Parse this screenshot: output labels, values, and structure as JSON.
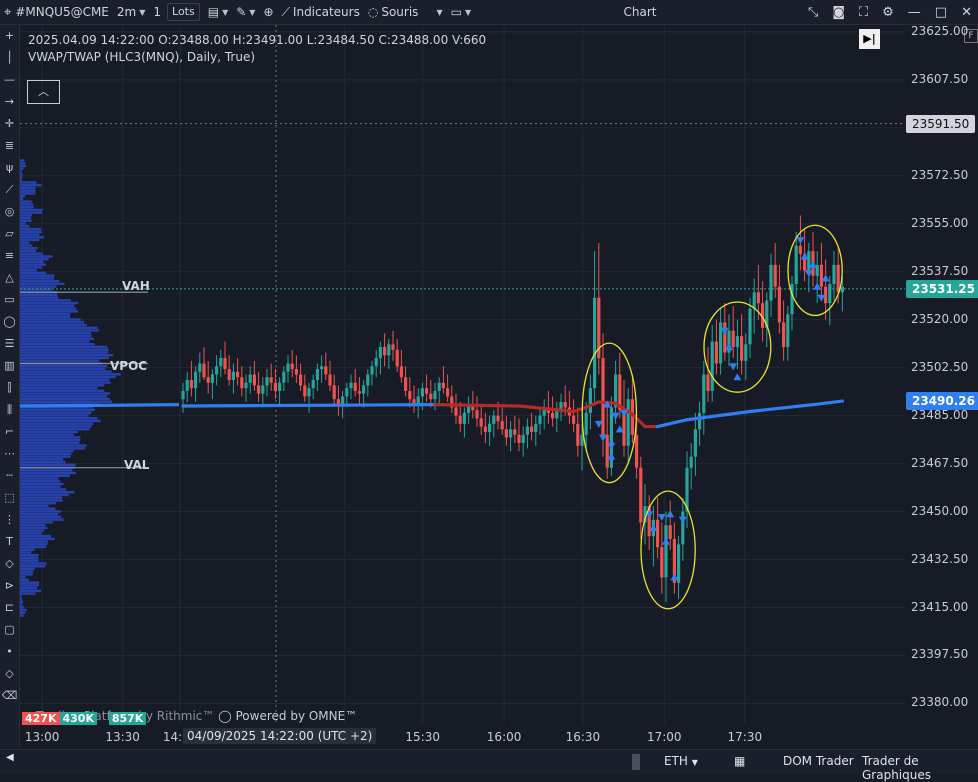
{
  "toolbar": {
    "symbol": "#MNQU5@CME",
    "timeframe": "2m",
    "lots_value": "1",
    "lots_unit": "Lots",
    "indicators_label": "Indicateurs",
    "mouse_label": "Souris",
    "window_title": "Chart"
  },
  "info": {
    "ohlc_line": "2025.04.09 14:22:00 O:23488.00 H:23491.00 L:23484.50 C:23488.00 V:660",
    "indicator_line": "VWAP/TWAP (HLC3(MNQ), Daily, True)"
  },
  "profile_labels": {
    "vah": "VAH",
    "vpoc": "VPOC",
    "val": "VAL"
  },
  "crosshair_time": "04/09/2025 14:22:00 (UTC +2)",
  "watermark": "Powered by OMNE™",
  "watermark_left": "Trading Platform by Rithmic™",
  "volume_labels": [
    "427K",
    "430K",
    "857K"
  ],
  "footer": {
    "session": "ETH",
    "dom": "DOM Trader",
    "trader": "Trader de Graphiques"
  },
  "colors": {
    "up": "#26a69a",
    "down": "#ef5350",
    "vwap_above": "#2f7ff0",
    "vwap_below": "#b52a2a",
    "background": "#161b26",
    "profile": "#2a49c7",
    "annotation": "#e8e52e"
  },
  "chart_data": {
    "type": "candlestick",
    "y_ticks": [
      "23625.00",
      "23607.50",
      "23590.00",
      "23572.50",
      "23555.00",
      "23537.50",
      "23520.00",
      "23502.50",
      "23485.00",
      "23467.50",
      "23450.00",
      "23432.50",
      "23415.00",
      "23397.50",
      "23380.00"
    ],
    "x_ticks": [
      "13:00",
      "13:30",
      "14:00",
      "15:00",
      "15:30",
      "16:00",
      "16:30",
      "17:00",
      "17:30"
    ],
    "x_tick_pos": [
      0.025,
      0.116,
      0.181,
      0.367,
      0.455,
      0.547,
      0.636,
      0.728,
      0.819
    ],
    "ylim": [
      23372.5,
      23627.5
    ],
    "price_tags": [
      {
        "value": "23591.50",
        "kind": "crosshair"
      },
      {
        "value": "23531.25",
        "kind": "last"
      },
      {
        "value": "23490.26",
        "kind": "vwap"
      }
    ],
    "levels": {
      "vah": 23530.0,
      "vpoc": 23504.0,
      "val": 23466.0
    },
    "candles": [
      [
        23491,
        23497,
        23486,
        23494
      ],
      [
        23494,
        23501,
        23490,
        23498
      ],
      [
        23498,
        23505,
        23492,
        23495
      ],
      [
        23495,
        23503,
        23490,
        23501
      ],
      [
        23501,
        23508,
        23497,
        23504
      ],
      [
        23504,
        23510,
        23498,
        23499
      ],
      [
        23499,
        23505,
        23493,
        23497
      ],
      [
        23497,
        23502,
        23491,
        23500
      ],
      [
        23500,
        23507,
        23496,
        23503
      ],
      [
        23503,
        23509,
        23499,
        23506
      ],
      [
        23506,
        23512,
        23500,
        23502
      ],
      [
        23502,
        23507,
        23496,
        23498
      ],
      [
        23498,
        23504,
        23493,
        23501
      ],
      [
        23501,
        23506,
        23496,
        23499
      ],
      [
        23499,
        23503,
        23492,
        23495
      ],
      [
        23495,
        23500,
        23490,
        23497
      ],
      [
        23497,
        23503,
        23493,
        23500
      ],
      [
        23500,
        23505,
        23494,
        23496
      ],
      [
        23496,
        23501,
        23490,
        23493
      ],
      [
        23493,
        23499,
        23488,
        23496
      ],
      [
        23496,
        23502,
        23492,
        23499
      ],
      [
        23499,
        23504,
        23494,
        23497
      ],
      [
        23497,
        23502,
        23491,
        23494
      ],
      [
        23494,
        23499,
        23489,
        23497
      ],
      [
        23497,
        23503,
        23494,
        23501
      ],
      [
        23501,
        23507,
        23497,
        23504
      ],
      [
        23504,
        23509,
        23499,
        23502
      ],
      [
        23502,
        23507,
        23497,
        23500
      ],
      [
        23500,
        23504,
        23494,
        23496
      ],
      [
        23496,
        23500,
        23490,
        23492
      ],
      [
        23492,
        23497,
        23486,
        23495
      ],
      [
        23495,
        23500,
        23491,
        23498
      ],
      [
        23498,
        23504,
        23494,
        23502
      ],
      [
        23502,
        23507,
        23497,
        23503
      ],
      [
        23503,
        23508,
        23498,
        23500
      ],
      [
        23500,
        23505,
        23494,
        23496
      ],
      [
        23496,
        23500,
        23489,
        23491
      ],
      [
        23491,
        23496,
        23485,
        23489
      ],
      [
        23489,
        23494,
        23484,
        23492
      ],
      [
        23492,
        23497,
        23488,
        23495
      ],
      [
        23495,
        23500,
        23491,
        23497
      ],
      [
        23497,
        23502,
        23492,
        23494
      ],
      [
        23494,
        23499,
        23489,
        23493
      ],
      [
        23493,
        23498,
        23488,
        23496
      ],
      [
        23496,
        23502,
        23492,
        23500
      ],
      [
        23500,
        23505,
        23496,
        23503
      ],
      [
        23503,
        23509,
        23499,
        23506
      ],
      [
        23506,
        23512,
        23500,
        23510
      ],
      [
        23510,
        23515,
        23503,
        23507
      ],
      [
        23507,
        23513,
        23502,
        23511
      ],
      [
        23511,
        23516,
        23505,
        23509
      ],
      [
        23509,
        23513,
        23501,
        23503
      ],
      [
        23503,
        23509,
        23497,
        23499
      ],
      [
        23499,
        23503,
        23492,
        23494
      ],
      [
        23494,
        23499,
        23488,
        23491
      ],
      [
        23491,
        23496,
        23486,
        23489
      ],
      [
        23489,
        23495,
        23484,
        23492
      ],
      [
        23492,
        23497,
        23487,
        23495
      ],
      [
        23495,
        23500,
        23490,
        23493
      ],
      [
        23493,
        23498,
        23488,
        23491
      ],
      [
        23491,
        23497,
        23487,
        23494
      ],
      [
        23494,
        23499,
        23489,
        23497
      ],
      [
        23497,
        23503,
        23493,
        23495
      ],
      [
        23495,
        23500,
        23490,
        23492
      ],
      [
        23492,
        23496,
        23486,
        23488
      ],
      [
        23488,
        23493,
        23482,
        23485
      ],
      [
        23485,
        23490,
        23479,
        23482
      ],
      [
        23482,
        23488,
        23477,
        23486
      ],
      [
        23486,
        23492,
        23482,
        23489
      ],
      [
        23489,
        23494,
        23484,
        23487
      ],
      [
        23487,
        23492,
        23481,
        23484
      ],
      [
        23484,
        23489,
        23478,
        23481
      ],
      [
        23481,
        23486,
        23475,
        23479
      ],
      [
        23479,
        23485,
        23474,
        23482
      ],
      [
        23482,
        23487,
        23477,
        23485
      ],
      [
        23485,
        23490,
        23480,
        23483
      ],
      [
        23483,
        23488,
        23478,
        23480
      ],
      [
        23480,
        23485,
        23474,
        23477
      ],
      [
        23477,
        23483,
        23472,
        23480
      ],
      [
        23480,
        23485,
        23475,
        23478
      ],
      [
        23478,
        23484,
        23472,
        23475
      ],
      [
        23475,
        23481,
        23470,
        23478
      ],
      [
        23478,
        23484,
        23473,
        23481
      ],
      [
        23481,
        23486,
        23476,
        23479
      ],
      [
        23479,
        23485,
        23474,
        23482
      ],
      [
        23482,
        23488,
        23478,
        23485
      ],
      [
        23485,
        23491,
        23480,
        23488
      ],
      [
        23488,
        23494,
        23482,
        23486
      ],
      [
        23486,
        23492,
        23481,
        23484
      ],
      [
        23484,
        23490,
        23479,
        23487
      ],
      [
        23487,
        23493,
        23483,
        23490
      ],
      [
        23490,
        23496,
        23485,
        23488
      ],
      [
        23488,
        23494,
        23482,
        23485
      ],
      [
        23485,
        23491,
        23479,
        23482
      ],
      [
        23482,
        23488,
        23470,
        23474
      ],
      [
        23474,
        23482,
        23465,
        23478
      ],
      [
        23478,
        23490,
        23472,
        23486
      ],
      [
        23486,
        23500,
        23480,
        23495
      ],
      [
        23495,
        23545,
        23490,
        23528
      ],
      [
        23528,
        23548,
        23500,
        23506
      ],
      [
        23506,
        23515,
        23470,
        23478
      ],
      [
        23478,
        23488,
        23462,
        23466
      ],
      [
        23466,
        23492,
        23463,
        23488
      ],
      [
        23488,
        23505,
        23482,
        23500
      ],
      [
        23500,
        23508,
        23484,
        23487
      ],
      [
        23487,
        23498,
        23470,
        23474
      ],
      [
        23474,
        23495,
        23468,
        23491
      ],
      [
        23491,
        23500,
        23475,
        23478
      ],
      [
        23478,
        23486,
        23462,
        23466
      ],
      [
        23466,
        23470,
        23440,
        23446
      ],
      [
        23446,
        23460,
        23438,
        23452
      ],
      [
        23452,
        23456,
        23436,
        23441
      ],
      [
        23441,
        23452,
        23430,
        23447
      ],
      [
        23447,
        23455,
        23433,
        23437
      ],
      [
        23437,
        23446,
        23420,
        23426
      ],
      [
        23426,
        23450,
        23417,
        23445
      ],
      [
        23445,
        23454,
        23436,
        23440
      ],
      [
        23440,
        23446,
        23420,
        23424
      ],
      [
        23424,
        23441,
        23418,
        23438
      ],
      [
        23438,
        23455,
        23432,
        23450
      ],
      [
        23450,
        23472,
        23444,
        23466
      ],
      [
        23466,
        23475,
        23458,
        23470
      ],
      [
        23470,
        23486,
        23463,
        23480
      ],
      [
        23480,
        23490,
        23474,
        23486
      ],
      [
        23486,
        23505,
        23478,
        23500
      ],
      [
        23500,
        23510,
        23490,
        23494
      ],
      [
        23494,
        23518,
        23490,
        23512
      ],
      [
        23512,
        23520,
        23500,
        23504
      ],
      [
        23504,
        23524,
        23500,
        23519
      ],
      [
        23519,
        23526,
        23505,
        23508
      ],
      [
        23508,
        23522,
        23503,
        23516
      ],
      [
        23516,
        23525,
        23506,
        23510
      ],
      [
        23510,
        23520,
        23502,
        23514
      ],
      [
        23514,
        23522,
        23500,
        23505
      ],
      [
        23505,
        23515,
        23498,
        23511
      ],
      [
        23511,
        23528,
        23506,
        23524
      ],
      [
        23524,
        23535,
        23515,
        23530
      ],
      [
        23530,
        23540,
        23520,
        23526
      ],
      [
        23526,
        23534,
        23512,
        23517
      ],
      [
        23517,
        23530,
        23510,
        23527
      ],
      [
        23527,
        23544,
        23521,
        23540
      ],
      [
        23540,
        23548,
        23528,
        23532
      ],
      [
        23532,
        23540,
        23515,
        23519
      ],
      [
        23519,
        23527,
        23505,
        23510
      ],
      [
        23510,
        23525,
        23505,
        23522
      ],
      [
        23522,
        23536,
        23516,
        23533
      ],
      [
        23533,
        23552,
        23528,
        23547
      ],
      [
        23547,
        23558,
        23538,
        23544
      ],
      [
        23544,
        23553,
        23534,
        23538
      ],
      [
        23538,
        23548,
        23530,
        23545
      ],
      [
        23545,
        23552,
        23532,
        23536
      ],
      [
        23536,
        23545,
        23526,
        23540
      ],
      [
        23540,
        23548,
        23528,
        23532
      ],
      [
        23532,
        23542,
        23520,
        23526
      ],
      [
        23526,
        23536,
        23518,
        23533
      ],
      [
        23533,
        23545,
        23527,
        23540
      ],
      [
        23540,
        23546,
        23526,
        23530
      ],
      [
        23530,
        23536,
        23523,
        23532
      ]
    ],
    "vwap": {
      "start_price": 23488.5,
      "points": [
        [
          0,
          23488.5
        ],
        [
          60,
          23489.0
        ],
        [
          80,
          23488.5
        ],
        [
          93,
          23486.5
        ],
        [
          96,
          23488.0
        ],
        [
          99,
          23490.0
        ],
        [
          103,
          23489.5
        ],
        [
          107,
          23485.5
        ],
        [
          110,
          23481.0
        ],
        [
          113,
          23481.0
        ],
        [
          120,
          23483.5
        ],
        [
          135,
          23486.5
        ],
        [
          150,
          23489.0
        ],
        [
          157,
          23490.3
        ]
      ]
    },
    "annotations": [
      {
        "x0": 96,
        "x1": 107,
        "y0": 23510,
        "y1": 23462
      },
      {
        "x0": 110,
        "x1": 121,
        "y0": 23456,
        "y1": 23416
      },
      {
        "x0": 125,
        "x1": 139,
        "y0": 23525,
        "y1": 23495
      },
      {
        "x0": 145,
        "x1": 156,
        "y0": 23553,
        "y1": 23523
      }
    ],
    "triangles": [
      {
        "bar": 99,
        "p": 23482,
        "up": false
      },
      {
        "bar": 100,
        "p": 23477,
        "up": false
      },
      {
        "bar": 101,
        "p": 23489,
        "up": true
      },
      {
        "bar": 103,
        "p": 23485,
        "up": false
      },
      {
        "bar": 104,
        "p": 23480,
        "up": true
      },
      {
        "bar": 105,
        "p": 23486,
        "up": false
      },
      {
        "bar": 102,
        "p": 23470,
        "up": true
      },
      {
        "bar": 102,
        "p": 23474,
        "up": false
      },
      {
        "bar": 111,
        "p": 23449,
        "up": false
      },
      {
        "bar": 112,
        "p": 23444,
        "up": true
      },
      {
        "bar": 114,
        "p": 23448,
        "up": false
      },
      {
        "bar": 115,
        "p": 23439,
        "up": true
      },
      {
        "bar": 116,
        "p": 23449,
        "up": true
      },
      {
        "bar": 117,
        "p": 23426,
        "up": true
      },
      {
        "bar": 119,
        "p": 23447,
        "up": false
      },
      {
        "bar": 129,
        "p": 23516,
        "up": false
      },
      {
        "bar": 130,
        "p": 23510,
        "up": true
      },
      {
        "bar": 131,
        "p": 23503,
        "up": false
      },
      {
        "bar": 132,
        "p": 23499,
        "up": true
      },
      {
        "bar": 147,
        "p": 23549,
        "up": false
      },
      {
        "bar": 148,
        "p": 23543,
        "up": true
      },
      {
        "bar": 149,
        "p": 23537,
        "up": false
      },
      {
        "bar": 150,
        "p": 23540,
        "up": true
      },
      {
        "bar": 151,
        "p": 23532,
        "up": true
      },
      {
        "bar": 152,
        "p": 23528,
        "up": false
      },
      {
        "bar": 153,
        "p": 23535,
        "up": true
      }
    ]
  }
}
